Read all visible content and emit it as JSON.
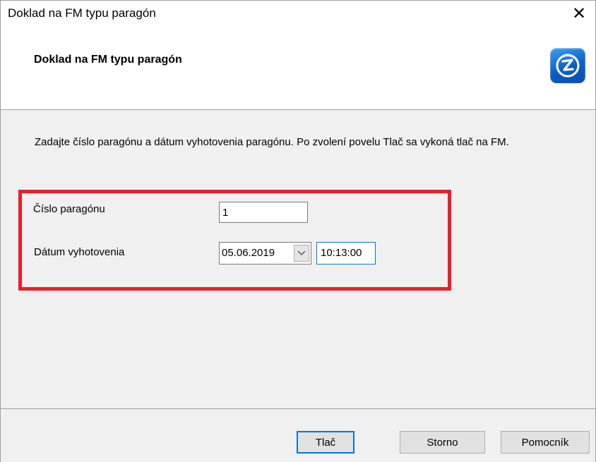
{
  "window": {
    "title": "Doklad na FM typu paragón",
    "close_glyph": "✕"
  },
  "header": {
    "title": "Doklad na FM typu paragón",
    "logo_icon": "app-logo-icon"
  },
  "description": "Zadajte číslo paragónu a dátum vyhotovenia paragónu. Po zvolení povelu Tlač sa vykoná tlač na FM.",
  "form": {
    "receipt_number_label": "Číslo paragónu",
    "receipt_number_value": "1",
    "date_label": "Dátum vyhotovenia",
    "date_value": "05.06.2019",
    "time_value": "10:13:00"
  },
  "buttons": {
    "print": "Tlač",
    "cancel": "Storno",
    "help": "Pomocník"
  },
  "colors": {
    "highlight": "#e8202a",
    "focus": "#0078d7",
    "logo": "#1a73d9"
  }
}
